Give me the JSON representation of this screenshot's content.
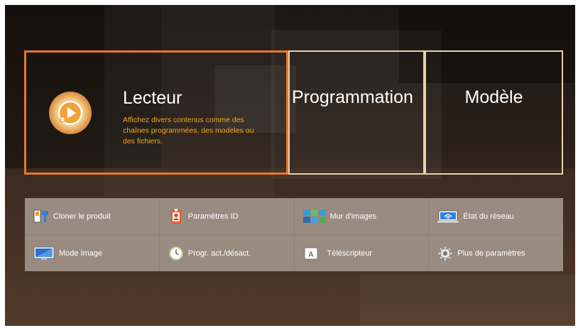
{
  "featured": {
    "title": "Lecteur",
    "description": "Affichez divers contenus comme des chaînes programmées, des modèles ou des fichiers."
  },
  "tiles": [
    {
      "label": "Programmation"
    },
    {
      "label": "Modèle"
    }
  ],
  "menu": [
    {
      "label": "Cloner le produit",
      "icon": "clone-icon"
    },
    {
      "label": "Paramètres ID",
      "icon": "id-badge-icon"
    },
    {
      "label": "Mur d'images",
      "icon": "video-wall-icon"
    },
    {
      "label": "État du réseau",
      "icon": "network-status-icon"
    },
    {
      "label": "Mode Image",
      "icon": "monitor-icon"
    },
    {
      "label": "Progr. act./désact.",
      "icon": "timer-icon"
    },
    {
      "label": "Téléscripteur",
      "icon": "ticker-icon"
    },
    {
      "label": "Plus de paramètres",
      "icon": "gear-icon"
    }
  ],
  "colors": {
    "focus_border": "#e8772e",
    "tile_border": "#e6d3a6",
    "description_text": "#f5a623",
    "background": "#2a211b"
  }
}
